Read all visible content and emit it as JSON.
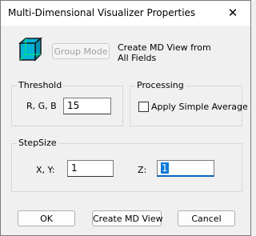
{
  "window": {
    "title": "Multi-Dimensional Visualizer Properties",
    "close_symbol": "✕"
  },
  "header": {
    "icon": "cube-icon",
    "group_mode_label": "Group Mode",
    "description_line1": "Create MD View from",
    "description_line2": "All Fields"
  },
  "threshold": {
    "label": "Threshold",
    "field_label": "R, G, B",
    "value": "15"
  },
  "processing": {
    "label": "Processing",
    "checkbox_label": "Apply Simple Average",
    "checked": false
  },
  "stepsize": {
    "label": "StepSize",
    "xy_label": "X, Y:",
    "xy_value": "1",
    "z_label": "Z:",
    "z_value": "1"
  },
  "buttons": {
    "ok": "OK",
    "create": "Create MD View",
    "cancel": "Cancel"
  },
  "colors": {
    "cube_front": "#00b4d8",
    "cube_outline": "#1a1a1a",
    "cube_inner": "#00e676",
    "focus_accent": "#0067c0"
  }
}
